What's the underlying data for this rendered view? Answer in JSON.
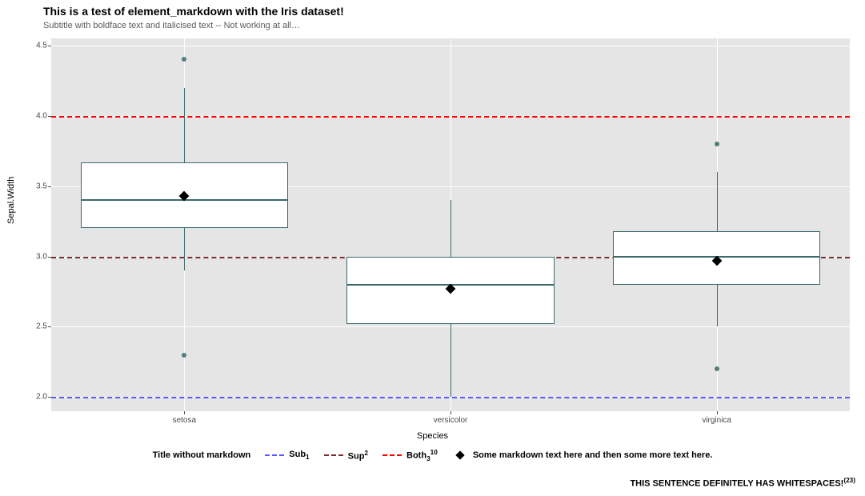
{
  "title": "This is a test of element_markdown with the Iris dataset!",
  "subtitle": "Subtitle with boldface text and italicised text -- Not working at all…",
  "xlabel": "Species",
  "ylabel": "Sepal.Width",
  "caption": "THIS SENTENCE DEFINITELY HAS WHITESPACES!",
  "caption_sup": "(23)",
  "legend": {
    "title": "Title without markdown",
    "sub": {
      "label": "Sub",
      "sub": "1",
      "color": "#5a5aff"
    },
    "sup": {
      "label": "Sup",
      "sup": "2",
      "color": "#7b2d2d"
    },
    "both": {
      "label": "Both",
      "sub": "3",
      "sup": "10",
      "color": "#ff0000"
    },
    "shape": "Some markdown text here and then some more text here."
  },
  "y_ticks": [
    "2.0",
    "2.5",
    "3.0",
    "3.5",
    "4.0",
    "4.5"
  ],
  "x_categories": [
    "setosa",
    "versicolor",
    "virginica"
  ],
  "ref_lines": [
    {
      "y": 2.0,
      "color": "#5a5aff"
    },
    {
      "y": 3.0,
      "color": "#7b2d2d"
    },
    {
      "y": 4.0,
      "color": "#ff0000"
    }
  ],
  "chart_data": {
    "type": "box",
    "title": "This is a test of element_markdown with the Iris dataset!",
    "xlabel": "Species",
    "ylabel": "Sepal.Width",
    "ylim": [
      1.9,
      4.55
    ],
    "categories": [
      "setosa",
      "versicolor",
      "virginica"
    ],
    "boxes": [
      {
        "category": "setosa",
        "min": 2.9,
        "q1": 3.2,
        "median": 3.4,
        "q3": 3.67,
        "max": 4.2,
        "mean": 3.43,
        "outliers": [
          2.3,
          4.4
        ]
      },
      {
        "category": "versicolor",
        "min": 2.0,
        "q1": 2.52,
        "median": 2.8,
        "q3": 3.0,
        "max": 3.4,
        "mean": 2.77,
        "outliers": []
      },
      {
        "category": "virginica",
        "min": 2.5,
        "q1": 2.8,
        "median": 3.0,
        "q3": 3.18,
        "max": 3.6,
        "mean": 2.97,
        "outliers": [
          2.2,
          3.8
        ]
      }
    ],
    "hlines": [
      {
        "y": 2.0,
        "color": "#5a5aff",
        "style": "dashed",
        "label": "Sub1"
      },
      {
        "y": 3.0,
        "color": "#7b2d2d",
        "style": "dashed",
        "label": "Sup2"
      },
      {
        "y": 4.0,
        "color": "#ff0000",
        "style": "dashed",
        "label": "Both3^10"
      }
    ]
  }
}
